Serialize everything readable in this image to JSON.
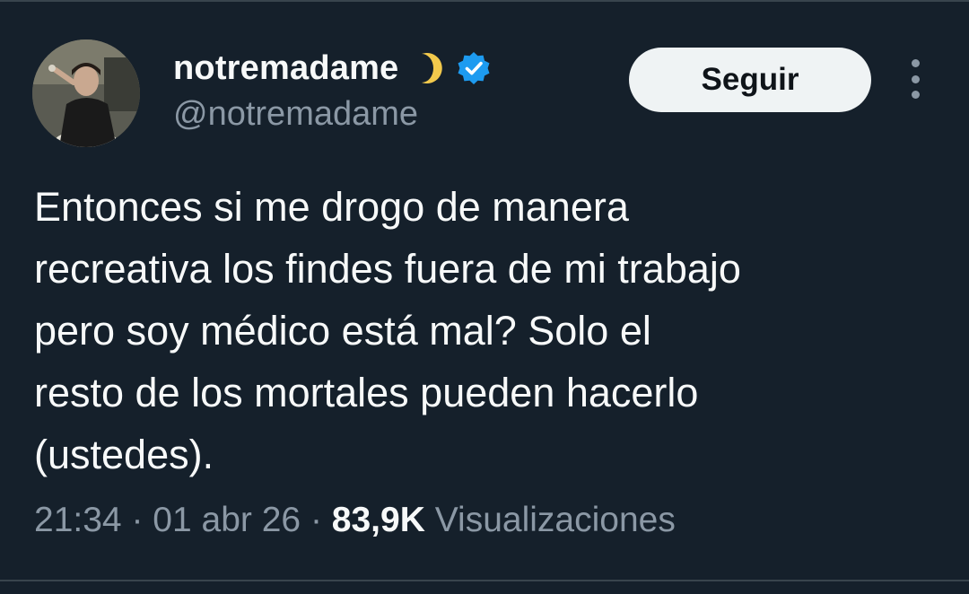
{
  "user": {
    "display_name": "notremadame",
    "emoji": "moon-icon",
    "verified": true,
    "verified_color": "#1d9bf0",
    "handle": "@notremadame"
  },
  "actions": {
    "follow_label": "Seguir",
    "more_icon": "more-options-icon"
  },
  "tweet": {
    "lines": [
      "Entonces si me drogo de manera",
      "recreativa los findes fuera de mi trabajo",
      "pero soy médico está mal? Solo el",
      "resto de los mortales pueden hacerlo",
      "(ustedes)."
    ]
  },
  "meta": {
    "time": "21:34",
    "separator": "·",
    "date": "01 abr 26",
    "views_count": "83,9K",
    "views_label": "Visualizaciones"
  },
  "colors": {
    "background": "#15202b",
    "text": "#f7f9f9",
    "muted": "#8b98a5",
    "button_bg": "#eff3f4"
  }
}
